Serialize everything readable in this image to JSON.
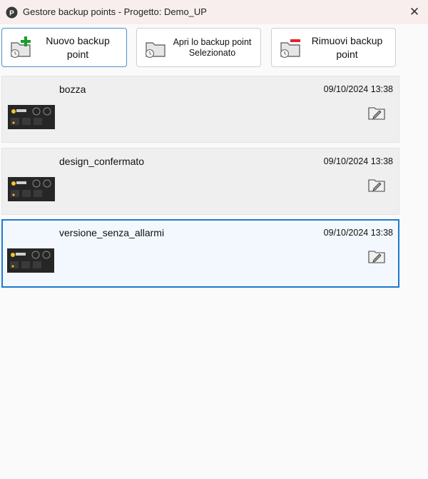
{
  "window": {
    "title": "Gestore backup points - Progetto: Demo_UP",
    "close_glyph": "✕"
  },
  "toolbar": {
    "new_label": "Nuovo backup\npoint",
    "open_label": "Apri lo backup point\nSelezionato",
    "remove_label": "Rimuovi backup\npoint"
  },
  "icons": {
    "app": "app-logo-icon",
    "new": "folder-add-icon",
    "open": "folder-icon",
    "remove": "folder-remove-icon",
    "edit": "edit-pencil-icon"
  },
  "colors": {
    "accent": "#1d79cf",
    "add_green": "#1a9e2b",
    "remove_red": "#e0242b"
  },
  "backup_points": [
    {
      "name": "bozza",
      "date": "09/10/2024 13:38",
      "selected": false
    },
    {
      "name": "design_confermato",
      "date": "09/10/2024 13:38",
      "selected": false
    },
    {
      "name": "versione_senza_allarmi",
      "date": "09/10/2024 13:38",
      "selected": true
    }
  ]
}
